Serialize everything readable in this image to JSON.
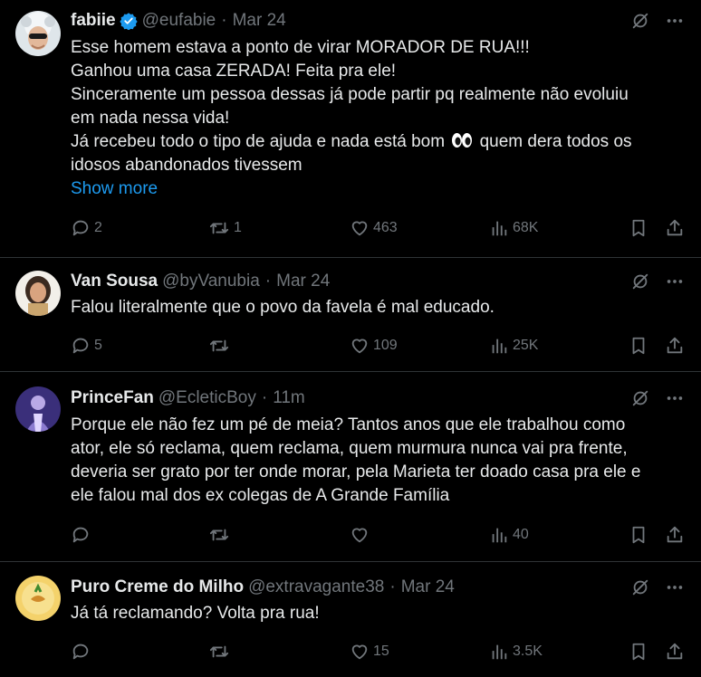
{
  "tweets": [
    {
      "name": "fabiie",
      "verified": true,
      "handle": "@eufabie",
      "time": "Mar 24",
      "lines": [
        "Esse homem estava a ponto de virar MORADOR DE RUA!!!",
        "Ganhou uma casa ZERADA! Feita pra ele!",
        "Sinceramente um pessoa dessas já pode partir pq realmente não evoluiu",
        "em nada nessa vida!",
        "Já recebeu todo o tipo de ajuda e nada está bom",
        "quem dera todos os",
        "idosos abandonados tivessem"
      ],
      "show_more": "Show more",
      "replies": "2",
      "reposts": "1",
      "likes": "463",
      "views": "68K"
    },
    {
      "name": "Van Sousa",
      "handle": "@byVanubia",
      "time": "Mar 24",
      "lines": [
        "Falou literalmente que o povo da favela é mal educado."
      ],
      "replies": "5",
      "reposts": "",
      "likes": "109",
      "views": "25K"
    },
    {
      "name": "PrinceFan",
      "handle": "@EcleticBoy",
      "time": "11m",
      "lines": [
        "Porque ele não fez um pé de meia? Tantos anos que ele trabalhou como",
        "ator, ele só reclama, quem reclama, quem murmura nunca vai pra frente,",
        "deveria ser grato por ter onde morar, pela Marieta ter doado casa pra ele e",
        "ele falou mal dos ex colegas de A Grande Família"
      ],
      "replies": "",
      "reposts": "",
      "likes": "",
      "views": "40"
    },
    {
      "name": "Puro Creme do Milho",
      "handle": "@extravagante38",
      "time": "Mar 24",
      "lines": [
        "Já tá reclamando? Volta pra rua!"
      ],
      "replies": "",
      "reposts": "",
      "likes": "15",
      "views": "3.5K"
    }
  ],
  "icons": {
    "grok": "grok-icon",
    "more": "more-icon",
    "reply": "reply-icon",
    "repost": "repost-icon",
    "like": "like-icon",
    "views": "views-icon",
    "bookmark": "bookmark-icon",
    "share": "share-icon"
  },
  "colors": {
    "background": "#000000",
    "text": "#e7e9ea",
    "muted": "#71767b",
    "link": "#1d9bf0",
    "divider": "#2f3336",
    "verified": "#1d9bf0"
  }
}
